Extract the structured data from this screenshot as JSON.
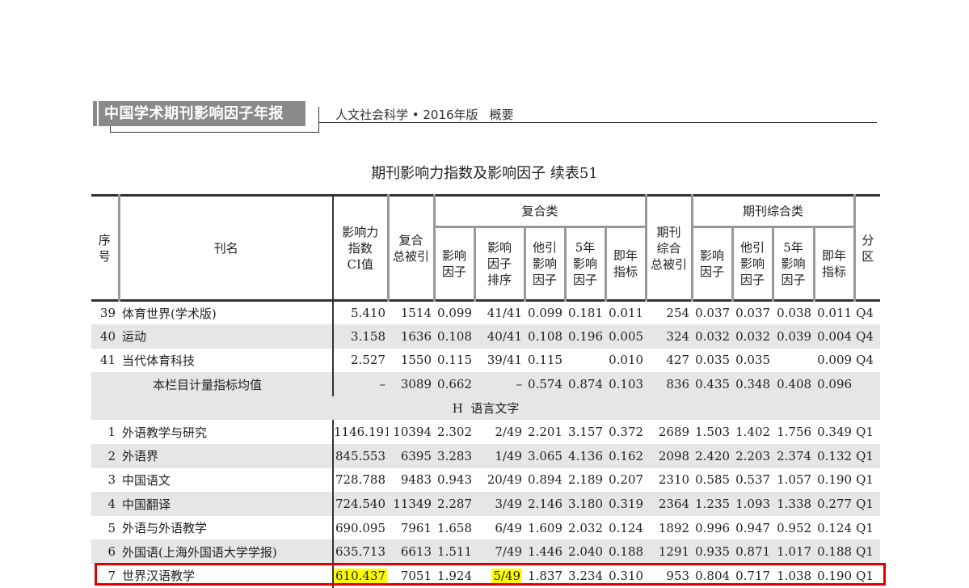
{
  "header": {
    "banner": "中国学术期刊影响因子年报",
    "subtitle_left": "人文社会科学 • 2016年版",
    "subtitle_right": "概要"
  },
  "table_title": "期刊影响力指数及影响因子  续表51",
  "columns": {
    "seq": "序\n号",
    "name": "刊名",
    "ci": "影响力\n指数\nCI值",
    "total_cited": "复合\n总被引",
    "group_composite": "复合类",
    "group_journal": "期刊综合类",
    "comp_if": "影响\n因子",
    "comp_rank": "影响\n因子\n排序",
    "comp_other_if": "他引\n影响\n因子",
    "comp_5yr": "5年\n影响\n因子",
    "comp_immediacy": "即年\n指标",
    "j_total_cited": "期刊\n综合\n总被引",
    "j_if": "影响\n因子",
    "j_other_if": "他引\n影响\n因子",
    "j_5yr": "5年\n影响\n因子",
    "j_immediacy": "即年\n指标",
    "quartile": "分\n区"
  },
  "rows_top": [
    {
      "seq": "39",
      "name": "体育世界(学术版)",
      "ci": "5.410",
      "tc": "1514",
      "if": "0.099",
      "rank": "41/41",
      "oif": "0.099",
      "f5": "0.181",
      "imm": "0.011",
      "jtc": "254",
      "jif": "0.037",
      "joif": "0.037",
      "j5": "0.038",
      "jimm": "0.011",
      "q": "Q4"
    },
    {
      "seq": "40",
      "name": "运动",
      "ci": "3.158",
      "tc": "1636",
      "if": "0.108",
      "rank": "40/41",
      "oif": "0.108",
      "f5": "0.196",
      "imm": "0.005",
      "jtc": "324",
      "jif": "0.032",
      "joif": "0.032",
      "j5": "0.039",
      "jimm": "0.004",
      "q": "Q4"
    },
    {
      "seq": "41",
      "name": "当代体育科技",
      "ci": "2.527",
      "tc": "1550",
      "if": "0.115",
      "rank": "39/41",
      "oif": "0.115",
      "f5": "",
      "imm": "0.010",
      "jtc": "427",
      "jif": "0.035",
      "joif": "0.035",
      "j5": "",
      "jimm": "0.009",
      "q": "Q4"
    },
    {
      "seq": "",
      "name": "本栏目计量指标均值",
      "ci": "–",
      "tc": "3089",
      "if": "0.662",
      "rank": "–",
      "oif": "0.574",
      "f5": "0.874",
      "imm": "0.103",
      "jtc": "836",
      "jif": "0.435",
      "joif": "0.348",
      "j5": "0.408",
      "jimm": "0.096",
      "q": ""
    }
  ],
  "section_label": "H  语言文字",
  "rows_bottom": [
    {
      "seq": "1",
      "name": "外语教学与研究",
      "ci": "1146.191",
      "tc": "10394",
      "if": "2.302",
      "rank": "2/49",
      "oif": "2.201",
      "f5": "3.157",
      "imm": "0.372",
      "jtc": "2689",
      "jif": "1.503",
      "joif": "1.402",
      "j5": "1.756",
      "jimm": "0.349",
      "q": "Q1"
    },
    {
      "seq": "2",
      "name": "外语界",
      "ci": "845.553",
      "tc": "6395",
      "if": "3.283",
      "rank": "1/49",
      "oif": "3.065",
      "f5": "4.136",
      "imm": "0.162",
      "jtc": "2098",
      "jif": "2.420",
      "joif": "2.203",
      "j5": "2.374",
      "jimm": "0.132",
      "q": "Q1"
    },
    {
      "seq": "3",
      "name": "中国语文",
      "ci": "728.788",
      "tc": "9483",
      "if": "0.943",
      "rank": "20/49",
      "oif": "0.894",
      "f5": "2.189",
      "imm": "0.207",
      "jtc": "2310",
      "jif": "0.585",
      "joif": "0.537",
      "j5": "1.057",
      "jimm": "0.190",
      "q": "Q1"
    },
    {
      "seq": "4",
      "name": "中国翻译",
      "ci": "724.540",
      "tc": "11349",
      "if": "2.287",
      "rank": "3/49",
      "oif": "2.146",
      "f5": "3.180",
      "imm": "0.319",
      "jtc": "2364",
      "jif": "1.235",
      "joif": "1.093",
      "j5": "1.338",
      "jimm": "0.277",
      "q": "Q1"
    },
    {
      "seq": "5",
      "name": "外语与外语教学",
      "ci": "690.095",
      "tc": "7961",
      "if": "1.658",
      "rank": "6/49",
      "oif": "1.609",
      "f5": "2.032",
      "imm": "0.124",
      "jtc": "1892",
      "jif": "0.996",
      "joif": "0.947",
      "j5": "0.952",
      "jimm": "0.124",
      "q": "Q1"
    },
    {
      "seq": "6",
      "name": "外国语(上海外国语大学学报)",
      "ci": "635.713",
      "tc": "6613",
      "if": "1.511",
      "rank": "7/49",
      "oif": "1.446",
      "f5": "2.040",
      "imm": "0.188",
      "jtc": "1291",
      "jif": "0.935",
      "joif": "0.871",
      "j5": "1.017",
      "jimm": "0.188",
      "q": "Q1"
    },
    {
      "seq": "7",
      "name": "世界汉语教学",
      "ci": "610.437",
      "tc": "7051",
      "if": "1.924",
      "rank": "5/49",
      "oif": "1.837",
      "f5": "3.234",
      "imm": "0.310",
      "jtc": "953",
      "jif": "0.804",
      "joif": "0.717",
      "j5": "1.038",
      "jimm": "0.190",
      "q": "Q1"
    }
  ]
}
